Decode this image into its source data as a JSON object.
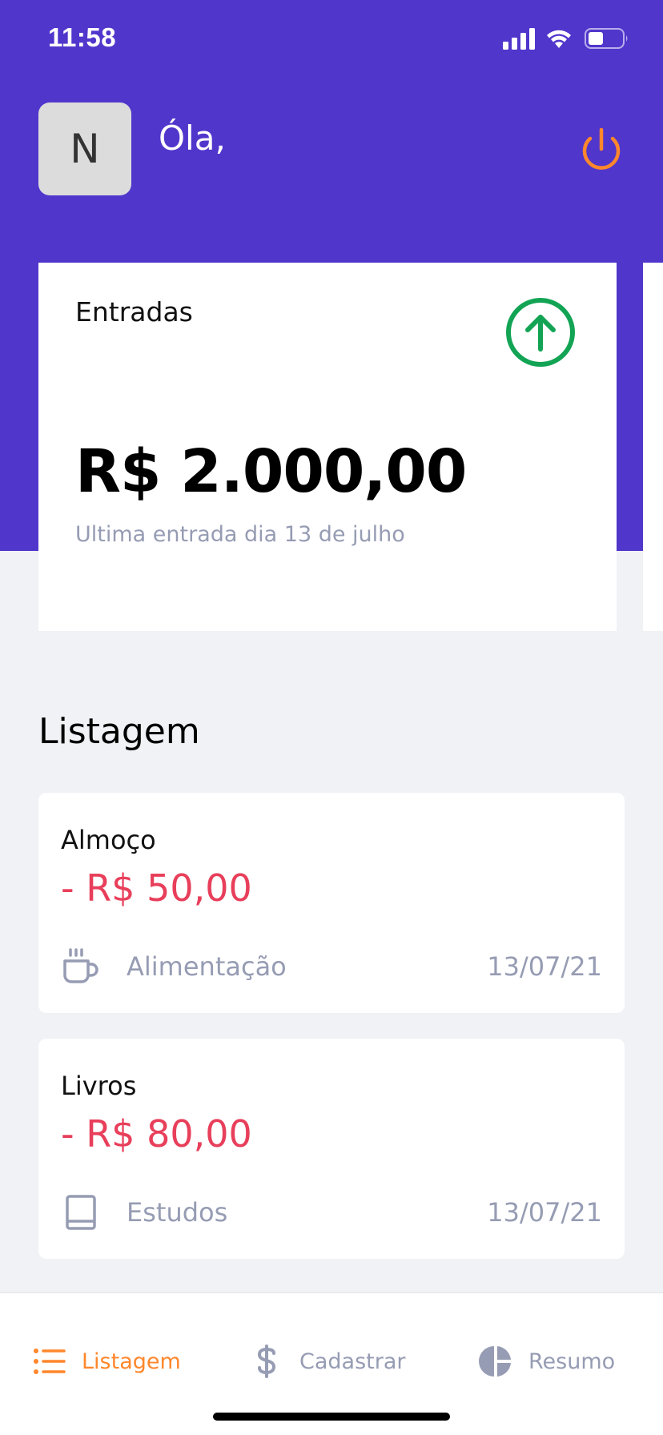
{
  "status_bar": {
    "time": "11:58"
  },
  "header": {
    "avatar_initial": "N",
    "greeting": "Óla,"
  },
  "highlight_card": {
    "title": "Entradas",
    "amount": "R$ 2.000,00",
    "subtitle": "Ultima entrada dia 13 de julho",
    "icon": "arrow-up-circle-icon"
  },
  "section": {
    "title": "Listagem"
  },
  "transactions": [
    {
      "title": "Almoço",
      "amount": "- R$ 50,00",
      "category": "Alimentação",
      "category_icon": "coffee-icon",
      "date": "13/07/21"
    },
    {
      "title": "Livros",
      "amount": "- R$ 80,00",
      "category": "Estudos",
      "category_icon": "book-icon",
      "date": "13/07/21"
    }
  ],
  "tabs": [
    {
      "label": "Listagem",
      "icon": "list-icon",
      "active": true
    },
    {
      "label": "Cadastrar",
      "icon": "dollar-sign-icon",
      "active": false
    },
    {
      "label": "Resumo",
      "icon": "pie-chart-icon",
      "active": false
    }
  ],
  "colors": {
    "primary": "#5136CC",
    "accent": "#FF872C",
    "success": "#12A454",
    "attention": "#E83F5B",
    "text_light": "#969CB3",
    "background": "#F0F2F5"
  }
}
